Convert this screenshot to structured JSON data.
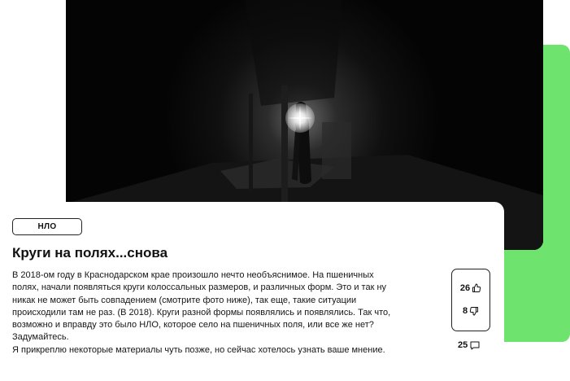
{
  "post": {
    "tag": "НЛО",
    "title": "Круги на полях...снова",
    "paragraph1": "В 2018-ом году в Краснодарском крае произошло нечто необъяснимое. На пшеничных полях, начали появляться круги колоссальных размеров, и различных форм. Это и так ну никак не может быть совпадением (смотрите фото ниже), так еще, такие ситуации происходили там не раз. (В 2018). Круги разной формы появлялись и появлялись. Так что, возможно и вправду это было НЛО, которое село на пшеничных поля, или все же нет?Задумайтесь.",
    "paragraph2": "Я прикреплю некоторые материалы чуть позже, но сейчас хотелось узнать ваше мнение."
  },
  "reactions": {
    "likes": "26",
    "dislikes": "8",
    "comments": "25"
  },
  "colors": {
    "accent_green": "#6ee36e",
    "photo_background": "#050505"
  },
  "icons": {
    "like": "thumbs-up-icon",
    "dislike": "thumbs-down-icon",
    "comments": "comment-icon"
  }
}
